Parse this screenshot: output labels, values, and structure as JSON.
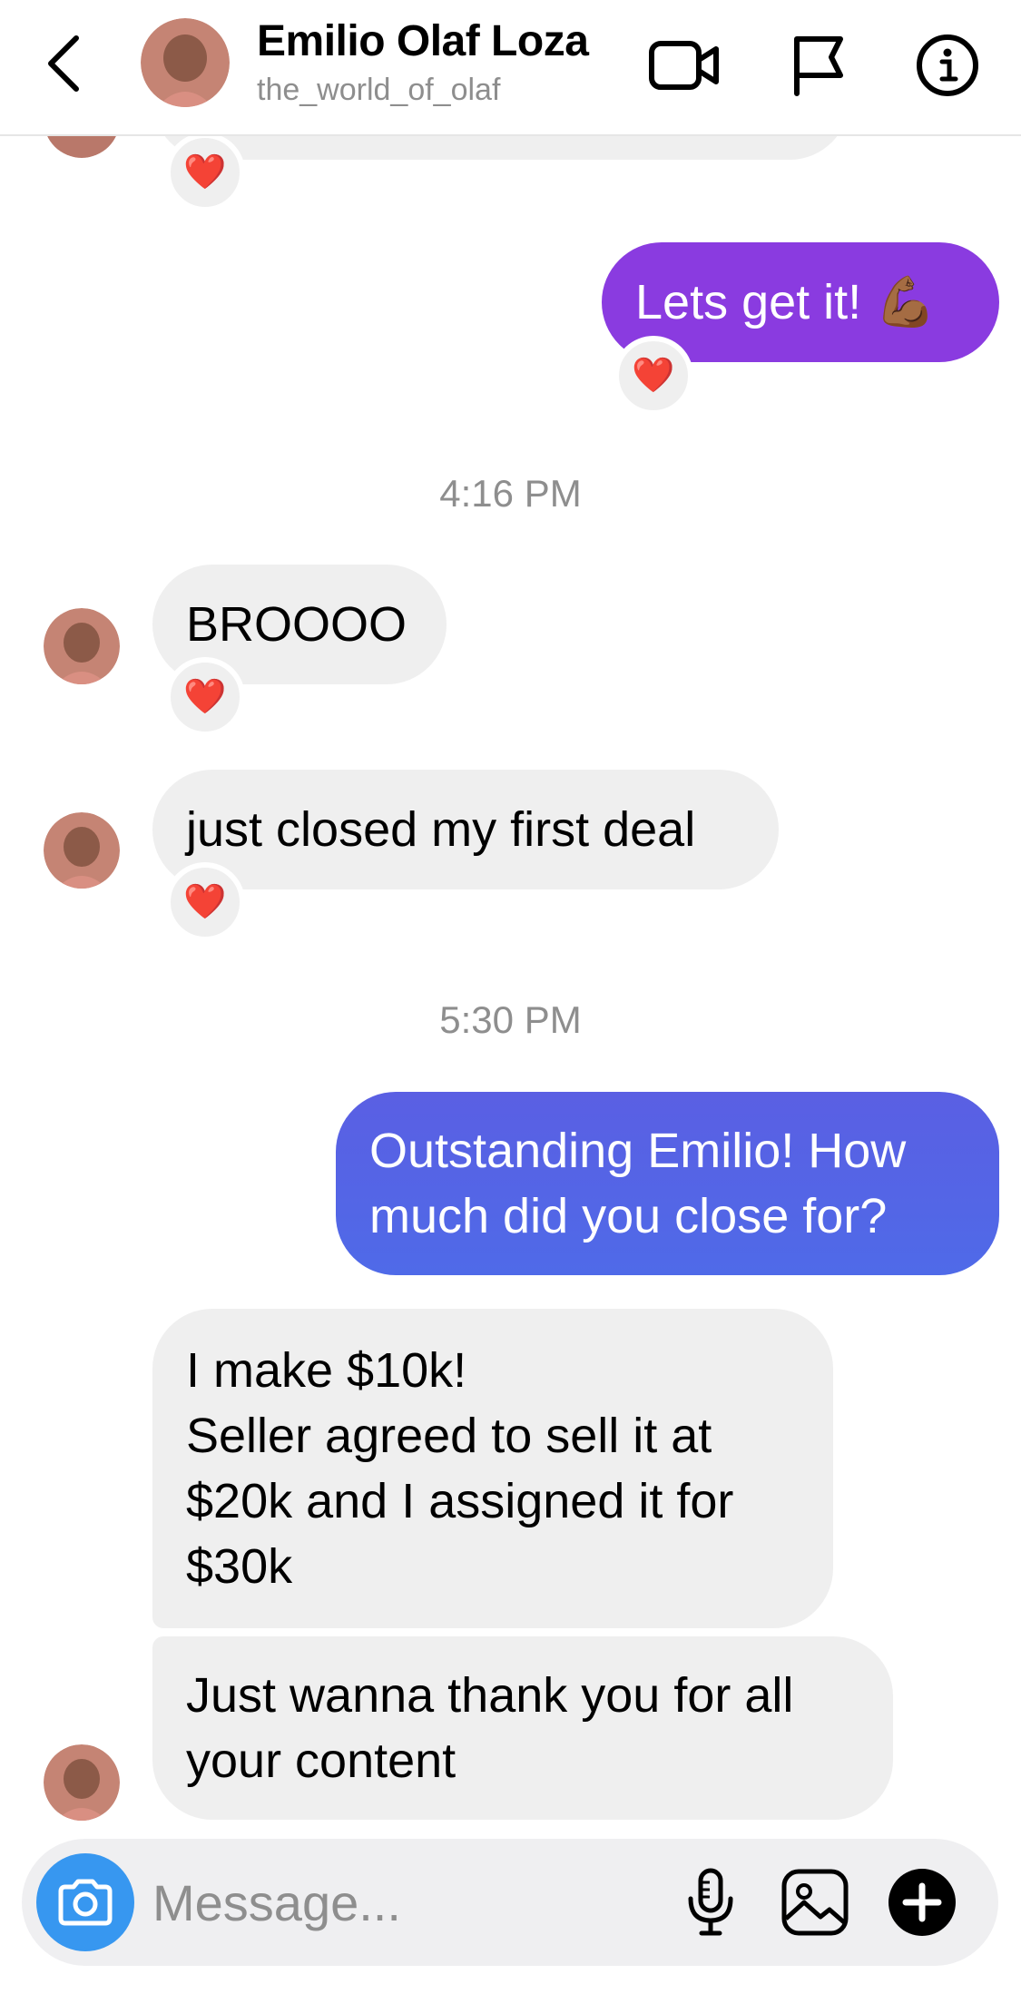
{
  "header": {
    "name": "Emilio Olaf Loza",
    "username": "the_world_of_olaf",
    "icons": [
      "chevron-left-icon",
      "video-camera-icon",
      "flag-icon",
      "info-icon"
    ]
  },
  "messages": [
    {
      "from": "me",
      "text": "Lets get it! 💪🏾",
      "reaction": "❤️"
    },
    {
      "timestamp": "4:16 PM"
    },
    {
      "from": "them",
      "text": "BROOOO",
      "reaction": "❤️"
    },
    {
      "from": "them",
      "text": "just closed my first deal",
      "reaction": "❤️"
    },
    {
      "timestamp": "5:30 PM"
    },
    {
      "from": "me",
      "lines": [
        "Outstanding Emilio! How",
        "much did you close for?"
      ]
    },
    {
      "from": "them",
      "lines": [
        "I make $10k!",
        "Seller agreed to sell it at",
        "$20k and I assigned it for",
        "$30k"
      ]
    },
    {
      "from": "them",
      "lines": [
        "Just wanna thank you for all",
        "your content"
      ]
    }
  ],
  "composer": {
    "placeholder": "Message...",
    "icons": [
      "camera-icon",
      "microphone-icon",
      "gallery-icon",
      "plus-icon"
    ]
  },
  "colors": {
    "outgoing_purple": "#8a3be0",
    "outgoing_blue": "#5565e6",
    "incoming_bg": "#efefef",
    "camera_blue": "#3797f0",
    "muted_text": "#8e8e8e"
  }
}
